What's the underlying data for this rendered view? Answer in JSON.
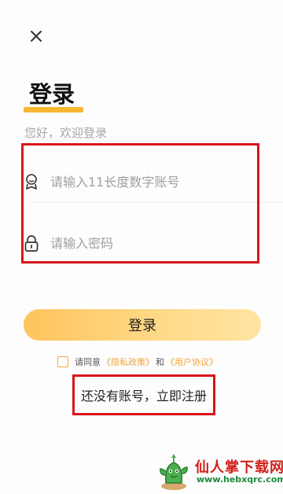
{
  "header": {
    "close_icon": "close-icon"
  },
  "title": {
    "text": "登录",
    "underline_color": "#f7b733"
  },
  "subtitle": "您好，欢迎登录",
  "account": {
    "icon": "user-badge-icon",
    "placeholder": "请输入11长度数字账号",
    "value": ""
  },
  "password": {
    "icon": "lock-icon",
    "placeholder": "请输入密码",
    "value": ""
  },
  "login_button": {
    "label": "登录"
  },
  "agreement": {
    "prefix": "请同意",
    "privacy_link": "《隐私政策》",
    "and": "和",
    "user_link": "《用户协议》",
    "link_color": "#f2a43c"
  },
  "register_link": "还没有账号，立即注册",
  "watermark": {
    "title": "仙人掌下载网",
    "url": "www.hebxqrc.com",
    "mascot_icon": "cactus-icon"
  }
}
